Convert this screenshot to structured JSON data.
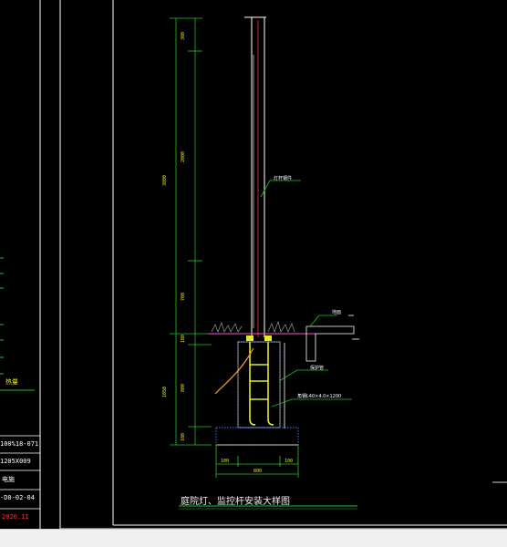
{
  "title_block": {
    "row1": "100%18-071",
    "row2": "1205X009",
    "row3": "电施",
    "row4": "-D0-02-04",
    "date": "2020.11"
  },
  "left_partial_label": "热量",
  "drawing": {
    "title": "庭院灯、监控杆安装大样图",
    "labels": {
      "pole_callout": "灯杆钢件",
      "ground_callout": "地面",
      "conduit_callout": "保护管",
      "anchor_callout": "角钢L40×4.0×1200"
    },
    "dimensions": {
      "top": "300",
      "total_height": "3800",
      "upper": "2000",
      "lower_mid": "700",
      "ground_gap": "100",
      "foundation_total": "1050",
      "foundation_mid": "800",
      "foundation_base": "100",
      "width_left": "100",
      "width_mid": "800",
      "width_right": "100"
    }
  },
  "colors": {
    "background": "#000000",
    "outline": "#ffffff",
    "dimension": "#e6e62a",
    "green": "#22c322",
    "red": "#ff3030",
    "magenta": "#ff4fd8",
    "blue": "#4a7bff",
    "orange": "#ff9a1f",
    "statusbar": "#f0f0f0"
  }
}
